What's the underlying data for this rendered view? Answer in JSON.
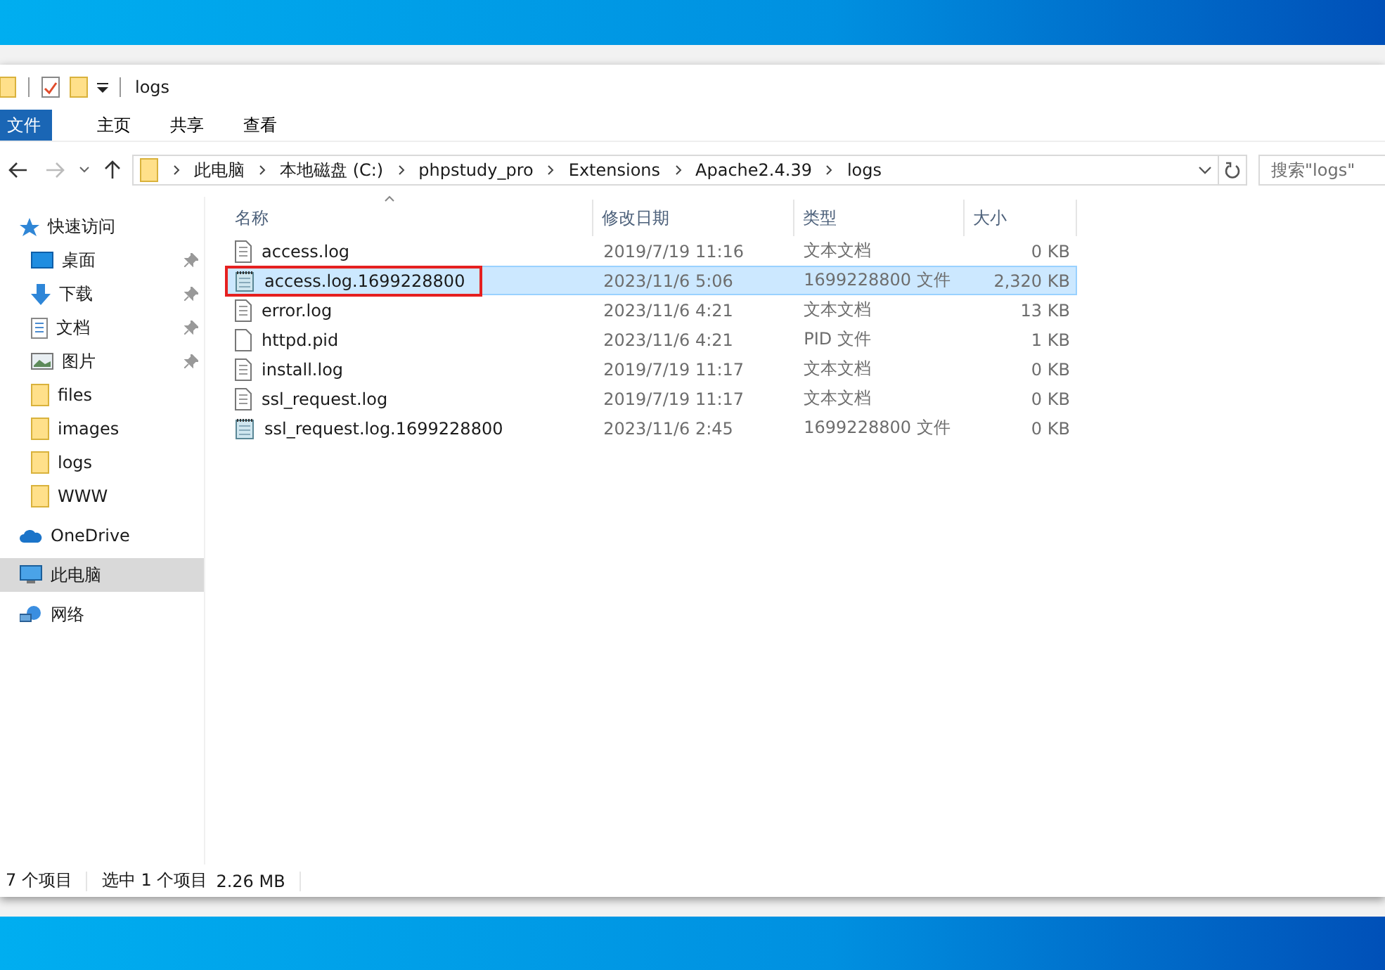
{
  "window": {
    "title": "logs"
  },
  "ribbon_tabs": [
    {
      "label": "文件",
      "kind": "file",
      "selected": false
    },
    {
      "label": "主页",
      "kind": "tab",
      "selected": false
    },
    {
      "label": "共享",
      "kind": "tab",
      "selected": false
    },
    {
      "label": "查看",
      "kind": "tab",
      "selected": false
    }
  ],
  "address": {
    "crumbs": [
      "此电脑",
      "本地磁盘 (C:)",
      "phpstudy_pro",
      "Extensions",
      "Apache2.4.39",
      "logs"
    ]
  },
  "search": {
    "placeholder": "搜索\"logs\""
  },
  "sidebar": [
    {
      "label": "快速访问",
      "kind": "star",
      "selected": false,
      "children": [
        {
          "label": "桌面",
          "kind": "desktop",
          "pinned": true,
          "selected": false
        },
        {
          "label": "下载",
          "kind": "download",
          "pinned": true,
          "selected": false
        },
        {
          "label": "文档",
          "kind": "document",
          "pinned": true,
          "selected": false
        },
        {
          "label": "图片",
          "kind": "image",
          "pinned": true,
          "selected": false
        },
        {
          "label": "files",
          "kind": "folder",
          "pinned": false,
          "selected": false
        },
        {
          "label": "images",
          "kind": "folder",
          "pinned": false,
          "selected": false
        },
        {
          "label": "logs",
          "kind": "folder",
          "pinned": false,
          "selected": false
        },
        {
          "label": "WWW",
          "kind": "folder",
          "pinned": false,
          "selected": false
        }
      ]
    },
    {
      "label": "OneDrive",
      "kind": "cloud",
      "selected": false
    },
    {
      "label": "此电脑",
      "kind": "computer",
      "selected": true
    },
    {
      "label": "网络",
      "kind": "network",
      "selected": false
    }
  ],
  "table": {
    "columns": [
      "名称",
      "修改日期",
      "类型",
      "大小"
    ],
    "rows": [
      {
        "name": "access.log",
        "date": "2019/7/19 11:16",
        "type": "文本文档",
        "size": "0 KB",
        "kind": "text",
        "selected": false,
        "outlined": false
      },
      {
        "name": "access.log.1699228800",
        "date": "2023/11/6 5:06",
        "type": "1699228800 文件",
        "size": "2,320 KB",
        "kind": "notepad",
        "selected": true,
        "outlined": true
      },
      {
        "name": "error.log",
        "date": "2023/11/6 4:21",
        "type": "文本文档",
        "size": "13 KB",
        "kind": "text",
        "selected": false,
        "outlined": false
      },
      {
        "name": "httpd.pid",
        "date": "2023/11/6 4:21",
        "type": "PID 文件",
        "size": "1 KB",
        "kind": "blank",
        "selected": false,
        "outlined": false
      },
      {
        "name": "install.log",
        "date": "2019/7/19 11:17",
        "type": "文本文档",
        "size": "0 KB",
        "kind": "text",
        "selected": false,
        "outlined": false
      },
      {
        "name": "ssl_request.log",
        "date": "2019/7/19 11:17",
        "type": "文本文档",
        "size": "0 KB",
        "kind": "text",
        "selected": false,
        "outlined": false
      },
      {
        "name": "ssl_request.log.1699228800",
        "date": "2023/11/6 2:45",
        "type": "1699228800 文件",
        "size": "0 KB",
        "kind": "notepad",
        "selected": false,
        "outlined": false
      }
    ]
  },
  "status_bar": {
    "count": "7 个项目",
    "selection": "选中 1 个项目",
    "selection_size": "2.26 MB"
  }
}
